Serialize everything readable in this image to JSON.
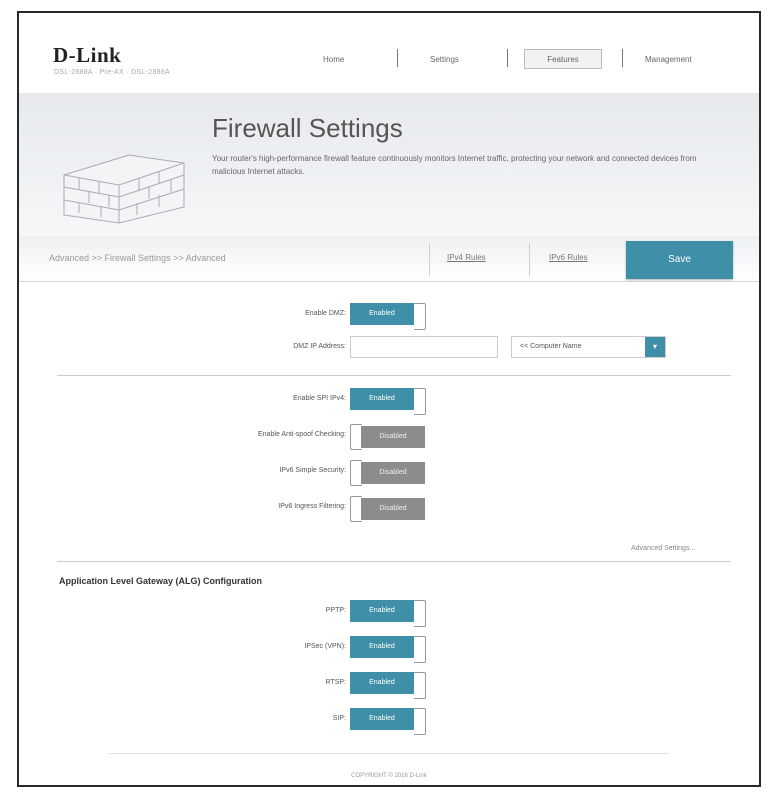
{
  "header": {
    "logo": "D-Link",
    "model": "DSL-2888A   ·   Pre-AX   ·   DSL-2888A",
    "nav": {
      "home": "Home",
      "settings": "Settings",
      "features": "Features",
      "management": "Management"
    }
  },
  "banner": {
    "title": "Firewall Settings",
    "description": "Your router's high-performance firewall feature continuously monitors Internet traffic, protecting your network and connected devices from malicious Internet attacks."
  },
  "breadcrumb": "Advanced >> Firewall Settings >> Advanced",
  "tabs": {
    "ipv4": "IPv4 Rules",
    "ipv6": "IPv6 Rules",
    "save": "Save"
  },
  "dmz": {
    "enable_label": "Enable DMZ:",
    "enable_state": "Enabled",
    "ip_label": "DMZ IP Address:",
    "ip_value": "",
    "computer_select": "<< Computer Name"
  },
  "firewall": [
    {
      "label": "Enable SPI IPv4:",
      "state": "Enabled",
      "on": true
    },
    {
      "label": "Enable Anti-spoof Checking:",
      "state": "Disabled",
      "on": false
    },
    {
      "label": "IPv6 Simple Security:",
      "state": "Disabled",
      "on": false
    },
    {
      "label": "IPv6 Ingress Filtering:",
      "state": "Disabled",
      "on": false
    }
  ],
  "advanced_link": "Advanced Settings...",
  "alg": {
    "title": "Application Level Gateway (ALG) Configuration",
    "items": [
      {
        "label": "PPTP:",
        "state": "Enabled",
        "on": true
      },
      {
        "label": "IPSec (VPN):",
        "state": "Enabled",
        "on": true
      },
      {
        "label": "RTSP:",
        "state": "Enabled",
        "on": true
      },
      {
        "label": "SIP:",
        "state": "Enabled",
        "on": true
      }
    ]
  },
  "copyright": "COPYRIGHT © 2016 D-Link",
  "colors": {
    "accent": "#3e8fa7",
    "disabled": "#8c8c8c"
  }
}
